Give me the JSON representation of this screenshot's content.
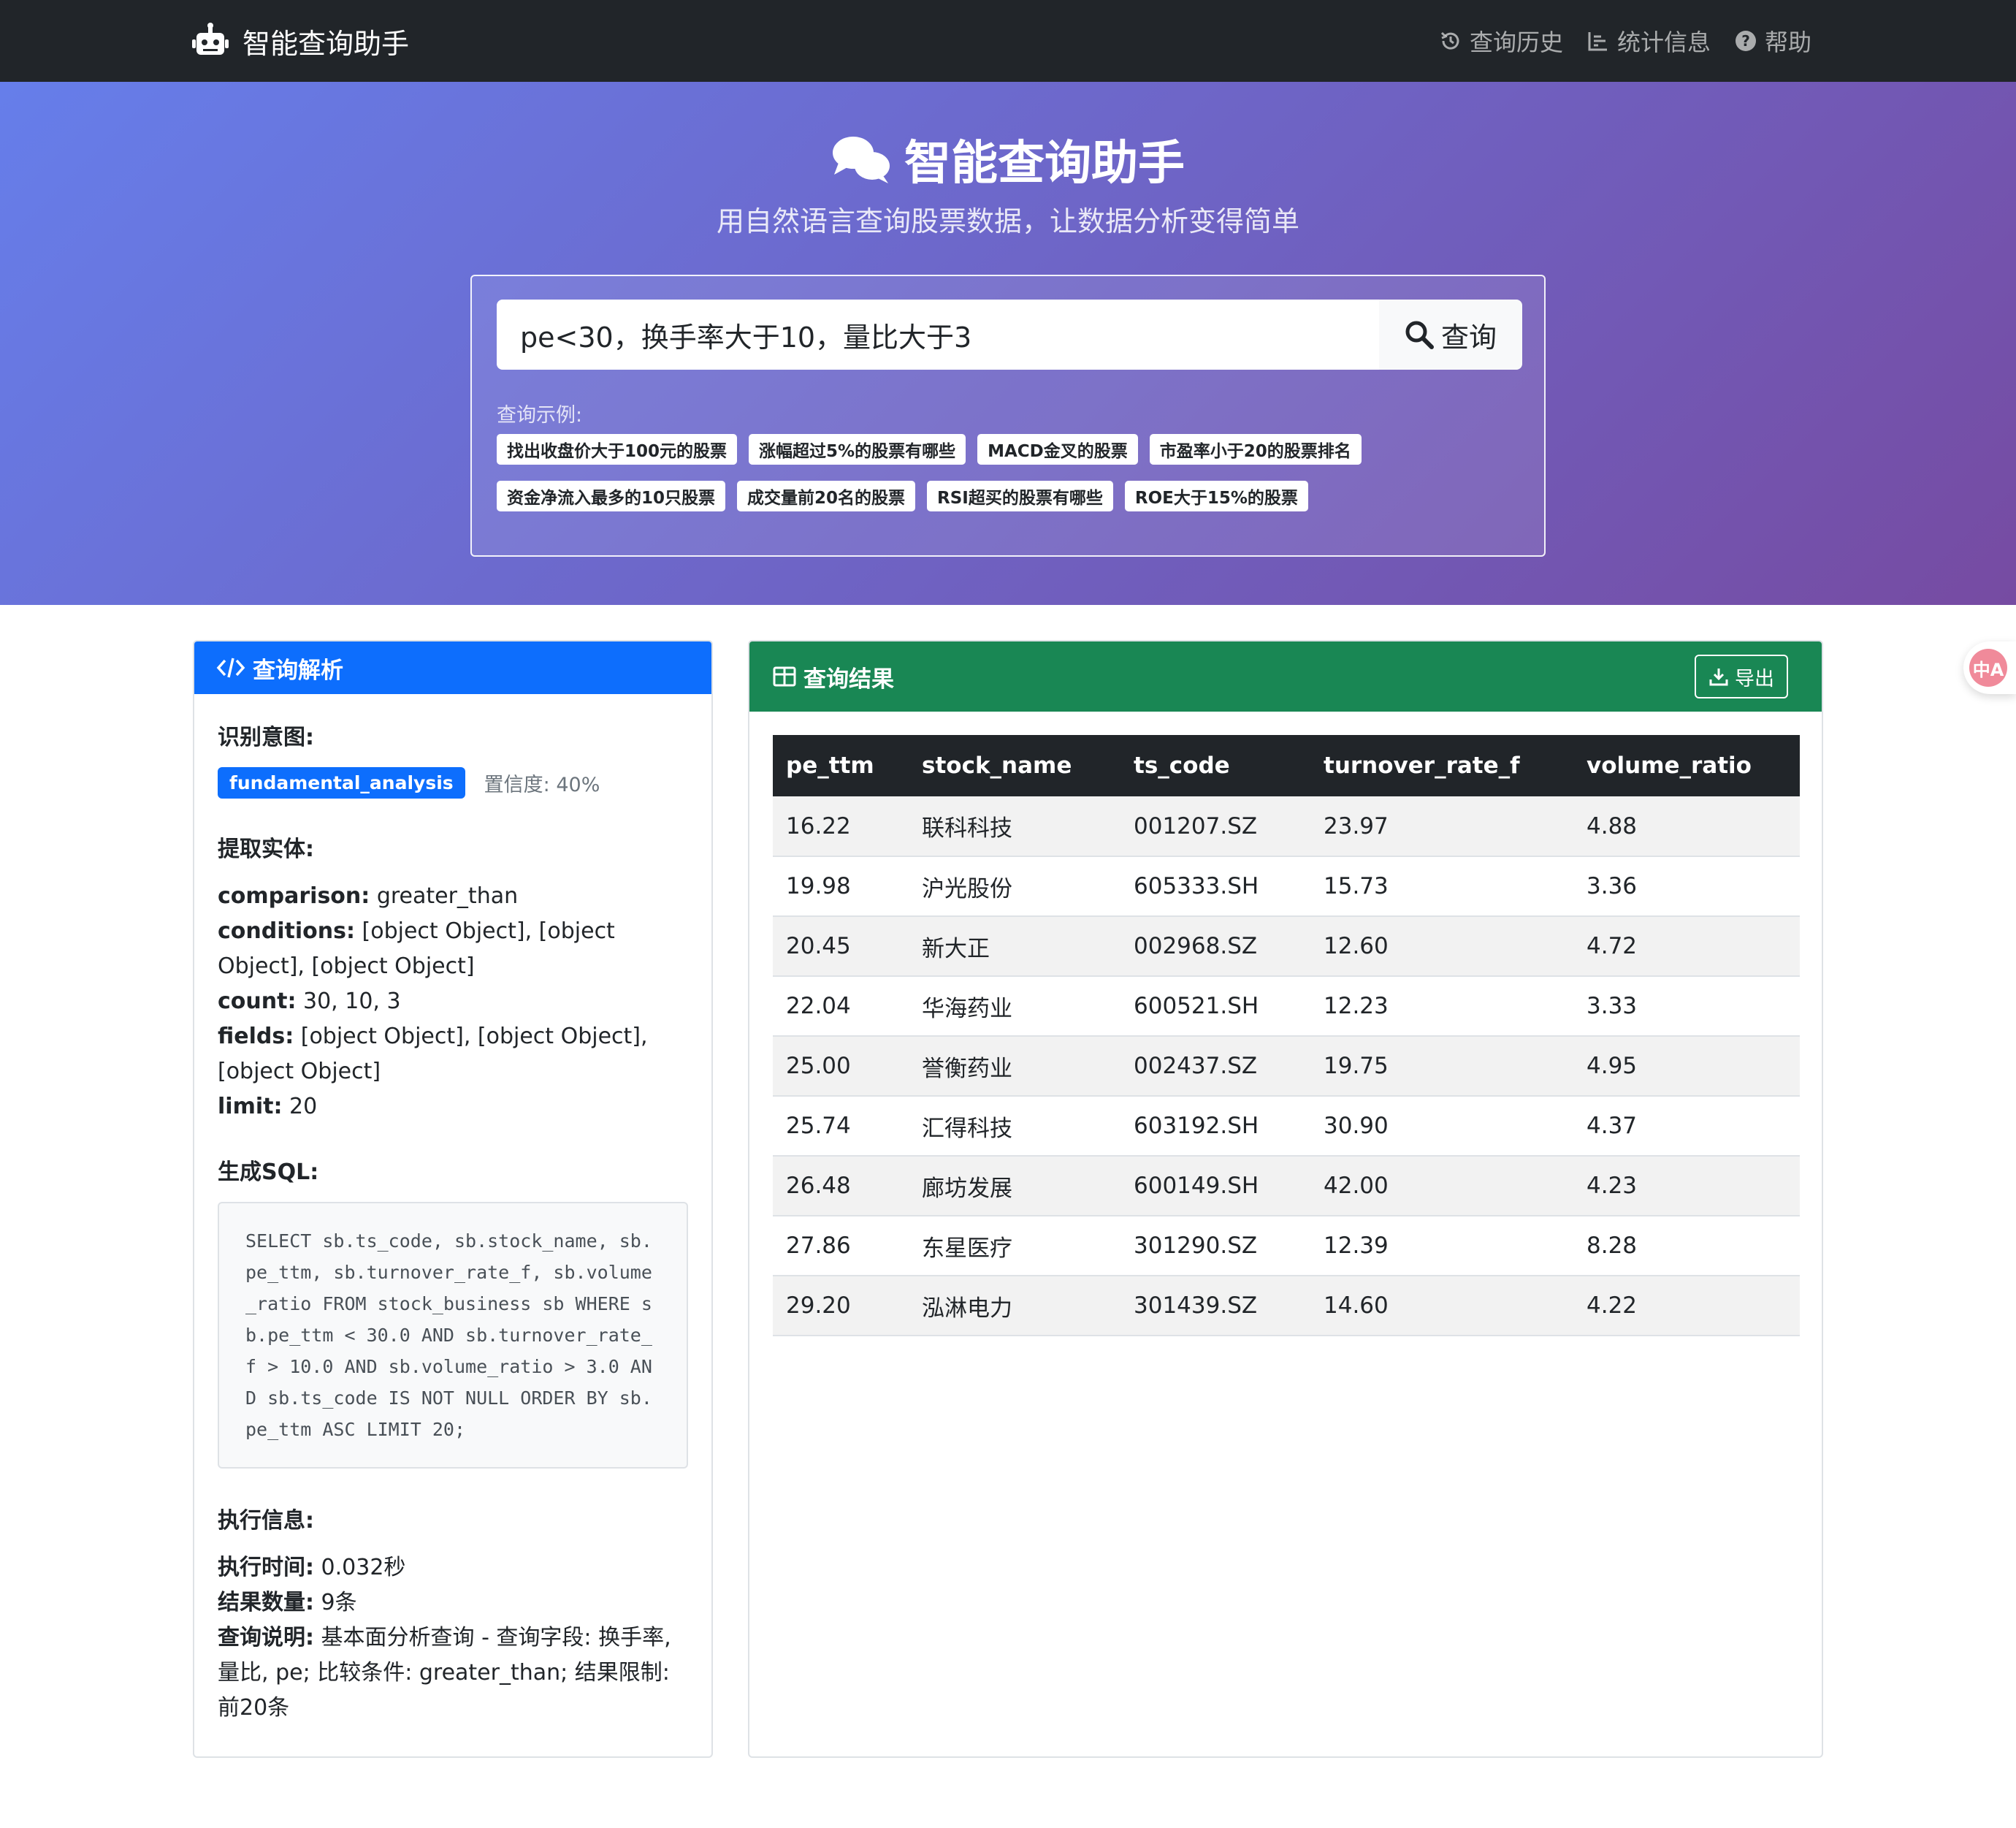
{
  "navbar": {
    "brand": "智能查询助手",
    "links": [
      "查询历史",
      "统计信息",
      "帮助"
    ]
  },
  "hero": {
    "title": "智能查询助手",
    "subtitle": "用自然语言查询股票数据，让数据分析变得简单"
  },
  "search": {
    "value": "pe<30，换手率大于10，量比大于3",
    "button": "查询",
    "examples_label": "查询示例:",
    "examples_row1": [
      "找出收盘价大于100元的股票",
      "涨幅超过5%的股票有哪些",
      "MACD金叉的股票",
      "市盈率小于20的股票排名"
    ],
    "examples_row2": [
      "资金净流入最多的10只股票",
      "成交量前20名的股票",
      "RSI超买的股票有哪些",
      "ROE大于15%的股票"
    ]
  },
  "analysis": {
    "header": "查询解析",
    "intent_heading": "识别意图:",
    "intent": "fundamental_analysis",
    "confidence": "置信度: 40%",
    "entities_heading": "提取实体:",
    "entities": [
      {
        "key": "comparison:",
        "value": " greater_than"
      },
      {
        "key": "conditions:",
        "value": " [object Object], [object Object], [object Object]"
      },
      {
        "key": "count:",
        "value": " 30, 10, 3"
      },
      {
        "key": "fields:",
        "value": " [object Object], [object Object], [object Object]"
      },
      {
        "key": "limit:",
        "value": " 20"
      }
    ],
    "sql_heading": "生成SQL:",
    "sql": "SELECT sb.ts_code, sb.stock_name, sb.pe_ttm, sb.turnover_rate_f, sb.volume_ratio FROM stock_business sb WHERE sb.pe_ttm < 30.0 AND sb.turnover_rate_f > 10.0 AND sb.volume_ratio > 3.0 AND sb.ts_code IS NOT NULL ORDER BY sb.pe_ttm ASC LIMIT 20;",
    "exec_heading": "执行信息:",
    "exec": [
      {
        "key": "执行时间:",
        "value": " 0.032秒"
      },
      {
        "key": "结果数量:",
        "value": " 9条"
      },
      {
        "key": "查询说明:",
        "value": " 基本面分析查询 - 查询字段: 换手率, 量比, pe; 比较条件: greater_than; 结果限制: 前20条"
      }
    ]
  },
  "results": {
    "header": "查询结果",
    "export": "导出",
    "columns": [
      "pe_ttm",
      "stock_name",
      "ts_code",
      "turnover_rate_f",
      "volume_ratio"
    ],
    "rows": [
      [
        "16.22",
        "联科科技",
        "001207.SZ",
        "23.97",
        "4.88"
      ],
      [
        "19.98",
        "沪光股份",
        "605333.SH",
        "15.73",
        "3.36"
      ],
      [
        "20.45",
        "新大正",
        "002968.SZ",
        "12.60",
        "4.72"
      ],
      [
        "22.04",
        "华海药业",
        "600521.SH",
        "12.23",
        "3.33"
      ],
      [
        "25.00",
        "誉衡药业",
        "002437.SZ",
        "19.75",
        "4.95"
      ],
      [
        "25.74",
        "汇得科技",
        "603192.SH",
        "30.90",
        "4.37"
      ],
      [
        "26.48",
        "廊坊发展",
        "600149.SH",
        "42.00",
        "4.23"
      ],
      [
        "27.86",
        "东星医疗",
        "301290.SZ",
        "12.39",
        "8.28"
      ],
      [
        "29.20",
        "泓淋电力",
        "301439.SZ",
        "14.60",
        "4.22"
      ]
    ]
  },
  "float": {
    "label": "中A"
  },
  "colors": {
    "navbar": "#212529",
    "primary": "#0d6efd",
    "success": "#198754",
    "gradient_start": "#667eea",
    "gradient_end": "#764ba2"
  }
}
